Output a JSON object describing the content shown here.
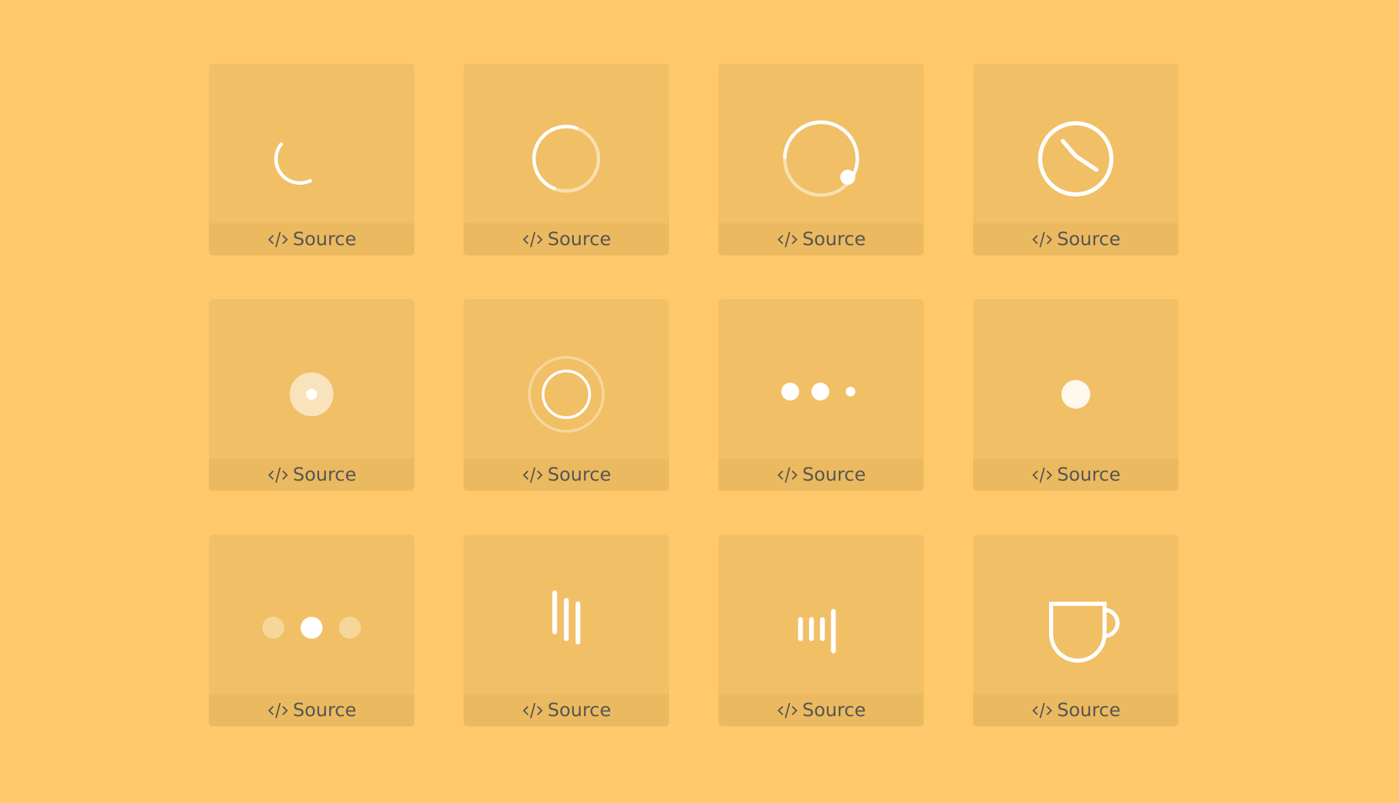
{
  "cards": [
    {
      "icon": "spinner-arc-icon",
      "source_label": "Source"
    },
    {
      "icon": "ring-progress-icon",
      "source_label": "Source"
    },
    {
      "icon": "orbit-dot-icon",
      "source_label": "Source"
    },
    {
      "icon": "clock-icon",
      "source_label": "Source"
    },
    {
      "icon": "pulse-disc-icon",
      "source_label": "Source"
    },
    {
      "icon": "double-ring-icon",
      "source_label": "Source"
    },
    {
      "icon": "three-dots-icon",
      "source_label": "Source"
    },
    {
      "icon": "single-dot-icon",
      "source_label": "Source"
    },
    {
      "icon": "fading-dots-icon",
      "source_label": "Source"
    },
    {
      "icon": "bars-icon",
      "source_label": "Source"
    },
    {
      "icon": "equalizer-icon",
      "source_label": "Source"
    },
    {
      "icon": "coffee-cup-icon",
      "source_label": "Source"
    }
  ],
  "colors": {
    "background": "#FFC96B",
    "card": "#F1BF66",
    "footer": "#EBB95F",
    "text": "#555555",
    "icon": "#FFFFFF"
  }
}
